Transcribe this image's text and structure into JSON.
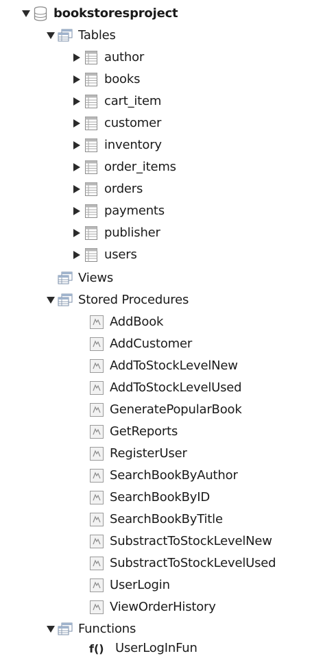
{
  "schema": {
    "name": "bookstoresproject",
    "icon": "database-icon",
    "expanded": true
  },
  "tables": {
    "label": "Tables",
    "icon": "table-folder-icon",
    "expanded": true,
    "items": [
      {
        "label": "author"
      },
      {
        "label": "books"
      },
      {
        "label": "cart_item"
      },
      {
        "label": "customer"
      },
      {
        "label": "inventory"
      },
      {
        "label": "order_items"
      },
      {
        "label": "orders"
      },
      {
        "label": "payments"
      },
      {
        "label": "publisher"
      },
      {
        "label": "users"
      }
    ]
  },
  "views": {
    "label": "Views",
    "icon": "view-folder-icon"
  },
  "procedures": {
    "label": "Stored Procedures",
    "icon": "procedure-folder-icon",
    "expanded": true,
    "items": [
      {
        "label": "AddBook"
      },
      {
        "label": "AddCustomer"
      },
      {
        "label": "AddToStockLevelNew"
      },
      {
        "label": "AddToStockLevelUsed"
      },
      {
        "label": "GeneratePopularBook"
      },
      {
        "label": "GetReports"
      },
      {
        "label": "RegisterUser"
      },
      {
        "label": "SearchBookByAuthor"
      },
      {
        "label": "SearchBookByID"
      },
      {
        "label": "SearchBookByTitle"
      },
      {
        "label": "SubstractToStockLevelNew"
      },
      {
        "label": "SubstractToStockLevelUsed"
      },
      {
        "label": "UserLogin"
      },
      {
        "label": "ViewOrderHistory"
      }
    ]
  },
  "functions": {
    "label": "Functions",
    "icon": "function-folder-icon",
    "expanded": true,
    "items": [
      {
        "label": "UserLogInFun",
        "icon_glyph": "f()"
      }
    ]
  },
  "colors": {
    "arrow": "#2b2b2b",
    "table_icon_border": "#8a8a8a",
    "table_icon_header": "#b8b8b8",
    "folder_blue": "#6f8fb5"
  }
}
